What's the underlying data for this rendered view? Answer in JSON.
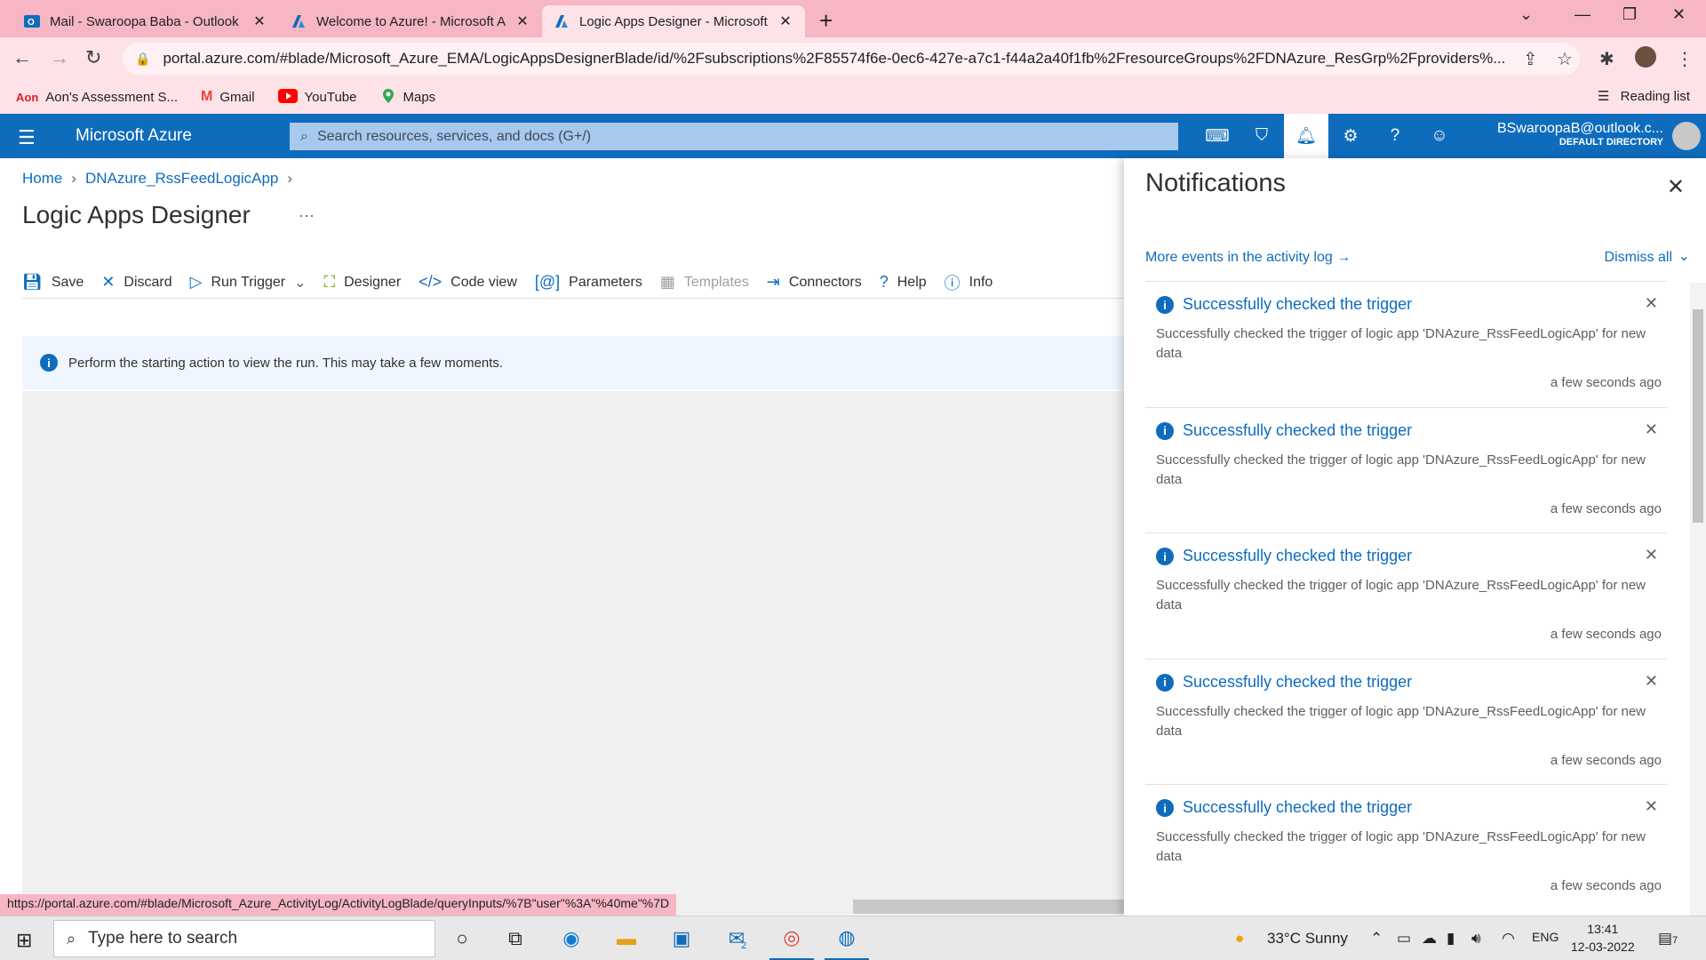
{
  "browser": {
    "tabs": [
      {
        "title": "Mail - Swaroopa Baba - Outlook",
        "icon": "outlook-icon"
      },
      {
        "title": "Welcome to Azure! - Microsoft A",
        "icon": "azure-icon"
      },
      {
        "title": "Logic Apps Designer - Microsoft",
        "icon": "azure-icon"
      }
    ],
    "url": "portal.azure.com/#blade/Microsoft_Azure_EMA/LogicAppsDesignerBlade/id/%2Fsubscriptions%2F85574f6e-0ec6-427e-a7c1-f44a2a40f1fb%2FresourceGroups%2FDNAzure_ResGrp%2Fproviders%...",
    "bookmarks": [
      {
        "label": "Aon's Assessment S...",
        "icon": "aon-icon"
      },
      {
        "label": "Gmail",
        "icon": "gmail-icon"
      },
      {
        "label": "YouTube",
        "icon": "youtube-icon"
      },
      {
        "label": "Maps",
        "icon": "maps-icon"
      }
    ],
    "reading_list": "Reading list",
    "status_url": "https://portal.azure.com/#blade/Microsoft_Azure_ActivityLog/ActivityLogBlade/queryInputs/%7B\"user\"%3A\"%40me\"%7D"
  },
  "azure": {
    "brand": "Microsoft Azure",
    "search_placeholder": "Search resources, services, and docs (G+/)",
    "user_email": "BSwaroopaB@outlook.c...",
    "directory": "DEFAULT DIRECTORY"
  },
  "blade": {
    "breadcrumb": [
      "Home",
      "DNAzure_RssFeedLogicApp"
    ],
    "title": "Logic Apps Designer",
    "toolbar": [
      {
        "label": "Save",
        "icon": "save-icon"
      },
      {
        "label": "Discard",
        "icon": "discard-icon"
      },
      {
        "label": "Run Trigger",
        "icon": "play-icon"
      },
      {
        "label": "Designer",
        "icon": "designer-icon"
      },
      {
        "label": "Code view",
        "icon": "code-icon"
      },
      {
        "label": "Parameters",
        "icon": "parameters-icon"
      },
      {
        "label": "Templates",
        "icon": "templates-icon"
      },
      {
        "label": "Connectors",
        "icon": "connectors-icon"
      },
      {
        "label": "Help",
        "icon": "help-icon"
      },
      {
        "label": "Info",
        "icon": "info-icon"
      }
    ],
    "info_message": "Perform the starting action to view the run. This may take a few moments."
  },
  "notifications": {
    "title": "Notifications",
    "more_events": "More events in the activity log →",
    "dismiss_all": "Dismiss all",
    "items": [
      {
        "title": "Successfully checked the trigger",
        "body": "Successfully checked the trigger of logic app 'DNAzure_RssFeedLogicApp' for new data",
        "time": "a few seconds ago"
      },
      {
        "title": "Successfully checked the trigger",
        "body": "Successfully checked the trigger of logic app 'DNAzure_RssFeedLogicApp' for new data",
        "time": "a few seconds ago"
      },
      {
        "title": "Successfully checked the trigger",
        "body": "Successfully checked the trigger of logic app 'DNAzure_RssFeedLogicApp' for new data",
        "time": "a few seconds ago"
      },
      {
        "title": "Successfully checked the trigger",
        "body": "Successfully checked the trigger of logic app 'DNAzure_RssFeedLogicApp' for new data",
        "time": "a few seconds ago"
      },
      {
        "title": "Successfully checked the trigger",
        "body": "Successfully checked the trigger of logic app 'DNAzure_RssFeedLogicApp' for new data",
        "time": "a few seconds ago"
      }
    ]
  },
  "taskbar": {
    "search_placeholder": "Type here to search",
    "weather": "33°C  Sunny",
    "language": "ENG",
    "time": "13:41",
    "date": "12-03-2022",
    "mail_badge": "2",
    "notif_badge": "7"
  },
  "colors": {
    "azure_blue": "#0f6cbd",
    "tab_bar_pink": "#f6b6c4"
  }
}
